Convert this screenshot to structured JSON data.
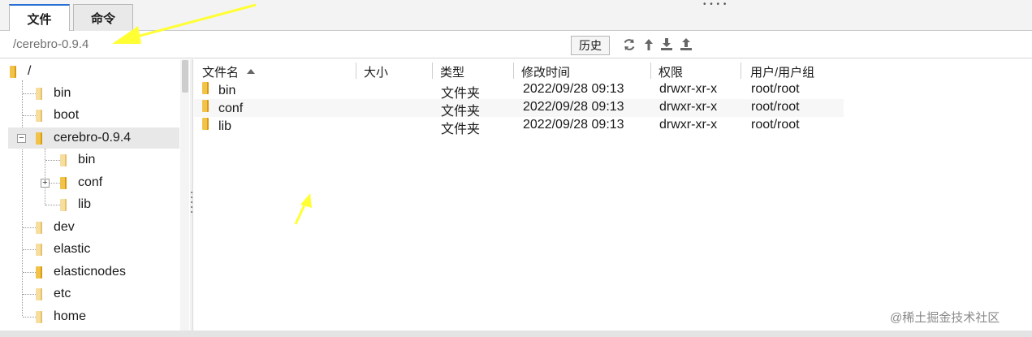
{
  "tabs": [
    {
      "label": "文件",
      "active": true
    },
    {
      "label": "命令",
      "active": false
    }
  ],
  "path": {
    "current": "/cerebro-0.9.4",
    "history_label": "历史"
  },
  "tree": {
    "root": "/",
    "items": [
      {
        "label": "bin"
      },
      {
        "label": "boot"
      },
      {
        "label": "cerebro-0.9.4",
        "selected": true,
        "expanded": true
      },
      {
        "label": "bin"
      },
      {
        "label": "conf"
      },
      {
        "label": "lib"
      },
      {
        "label": "dev"
      },
      {
        "label": "elastic"
      },
      {
        "label": "elasticnodes"
      },
      {
        "label": "etc"
      },
      {
        "label": "home"
      }
    ]
  },
  "columns": [
    "文件名",
    "大小",
    "类型",
    "修改时间",
    "权限",
    "用户/用户组"
  ],
  "files": [
    {
      "name": "bin",
      "size": "",
      "type": "文件夹",
      "modified": "2022/09/28 09:13",
      "perm": "drwxr-xr-x",
      "owner": "root/root"
    },
    {
      "name": "conf",
      "size": "",
      "type": "文件夹",
      "modified": "2022/09/28 09:13",
      "perm": "drwxr-xr-x",
      "owner": "root/root"
    },
    {
      "name": "lib",
      "size": "",
      "type": "文件夹",
      "modified": "2022/09/28 09:13",
      "perm": "drwxr-xr-x",
      "owner": "root/root"
    }
  ],
  "toolbar_icons": [
    "refresh-icon",
    "up-icon",
    "download-icon",
    "upload-icon"
  ],
  "watermark": "@稀土掘金技术社区",
  "colors": {
    "folder": "#f2c34a",
    "accent": "#2a6fd6",
    "annotation": "#ffff33"
  }
}
